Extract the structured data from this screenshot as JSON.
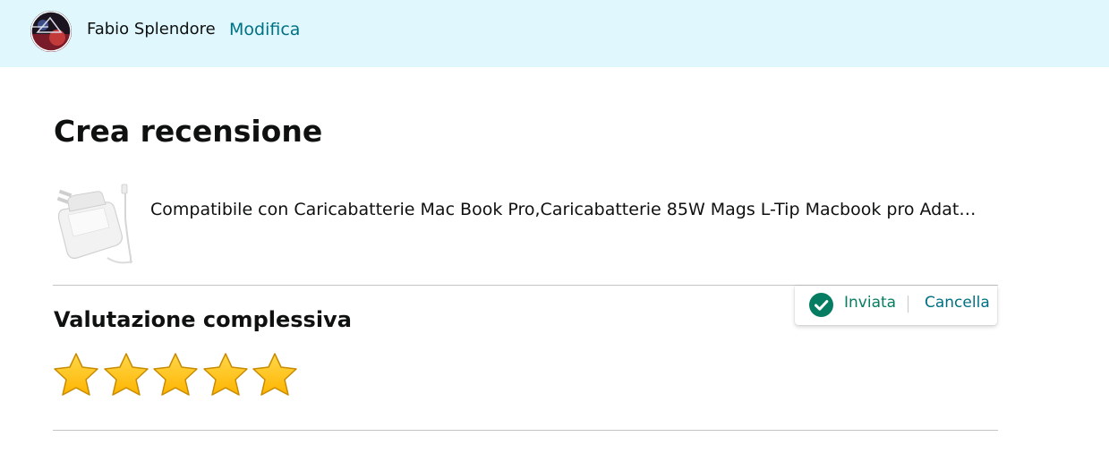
{
  "header": {
    "user_name": "Fabio Splendore",
    "edit_label": "Modifica",
    "avatar_icon": "user-avatar"
  },
  "page": {
    "title": "Crea recensione"
  },
  "product": {
    "title": "Compatibile con Caricabatterie Mac Book Pro,Caricabatterie 85W Mags L-Tip Macbook pro Adat…",
    "image_icon": "power-adapter-thumbnail"
  },
  "rating": {
    "section_title": "Valutazione complessiva",
    "value": 5,
    "max": 5,
    "star_color": "#ffb400"
  },
  "status": {
    "label": "Inviata",
    "cancel_label": "Cancella",
    "icon": "check-circle-icon",
    "color": "#067d62"
  },
  "colors": {
    "header_bg": "#dff7fd",
    "link": "#007185"
  }
}
